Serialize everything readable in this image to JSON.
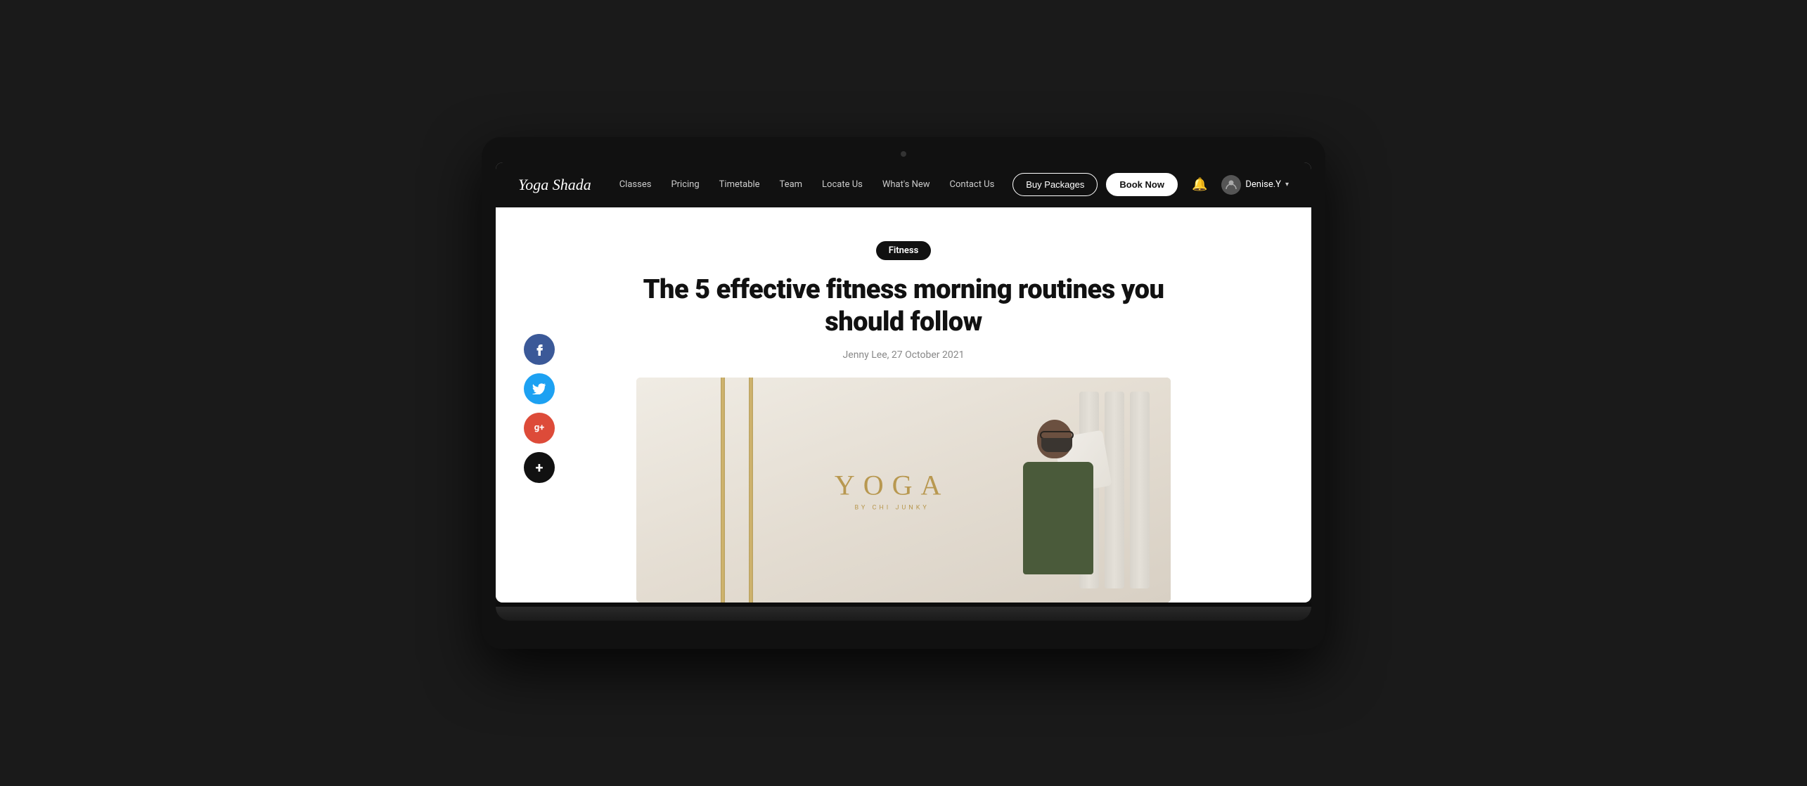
{
  "brand": {
    "logo_text_1": "Yoga",
    "logo_text_2": "Shada"
  },
  "navbar": {
    "links": [
      {
        "id": "classes",
        "label": "Classes"
      },
      {
        "id": "pricing",
        "label": "Pricing"
      },
      {
        "id": "timetable",
        "label": "Timetable"
      },
      {
        "id": "team",
        "label": "Team"
      },
      {
        "id": "locate-us",
        "label": "Locate Us"
      },
      {
        "id": "whats-new",
        "label": "What's New"
      },
      {
        "id": "contact-us",
        "label": "Contact Us"
      }
    ],
    "btn_buy_packages": "Buy Packages",
    "btn_book_now": "Book Now",
    "user_name": "Denise.Y"
  },
  "article": {
    "badge": "Fitness",
    "title": "The 5 effective fitness morning routines you should follow",
    "author": "Jenny Lee",
    "date": "27 October 2021",
    "meta": "Jenny Lee, 27 October 2021"
  },
  "social": {
    "facebook_icon": "f",
    "twitter_icon": "t",
    "google_icon": "g+",
    "more_icon": "+"
  },
  "image": {
    "yoga_text": "YOGA",
    "yoga_subtext": "BY CHI JUNKY"
  },
  "colors": {
    "navbar_bg": "#111111",
    "badge_bg": "#111111",
    "facebook": "#3b5998",
    "twitter": "#1da1f2",
    "google": "#dd4b39",
    "more": "#111111"
  }
}
